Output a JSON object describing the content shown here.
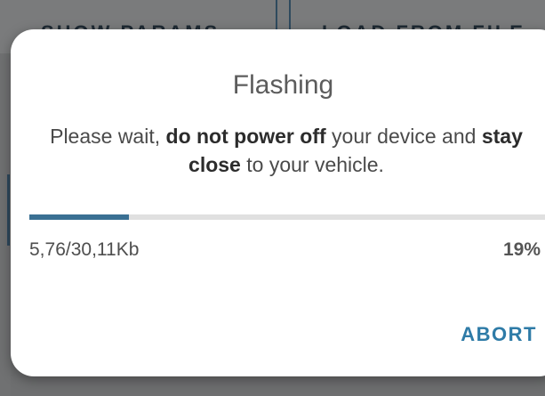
{
  "background": {
    "left_button_label": "SHOW PARAMS",
    "right_button_label": "LOAD FROM FILE"
  },
  "dialog": {
    "title": "Flashing",
    "message_part1": "Please wait, ",
    "message_bold1": "do not power off",
    "message_part2": " your device and ",
    "message_bold2": "stay close",
    "message_part3": " to your vehicle.",
    "progress_fraction": 0.19,
    "progress_caption": "5,76/30,11Kb",
    "progress_percent": "19%",
    "abort_label": "ABORT"
  },
  "colors": {
    "accent": "#2e7ba7",
    "progress_fill": "#3a7093",
    "progress_track": "#e0e0e0"
  }
}
